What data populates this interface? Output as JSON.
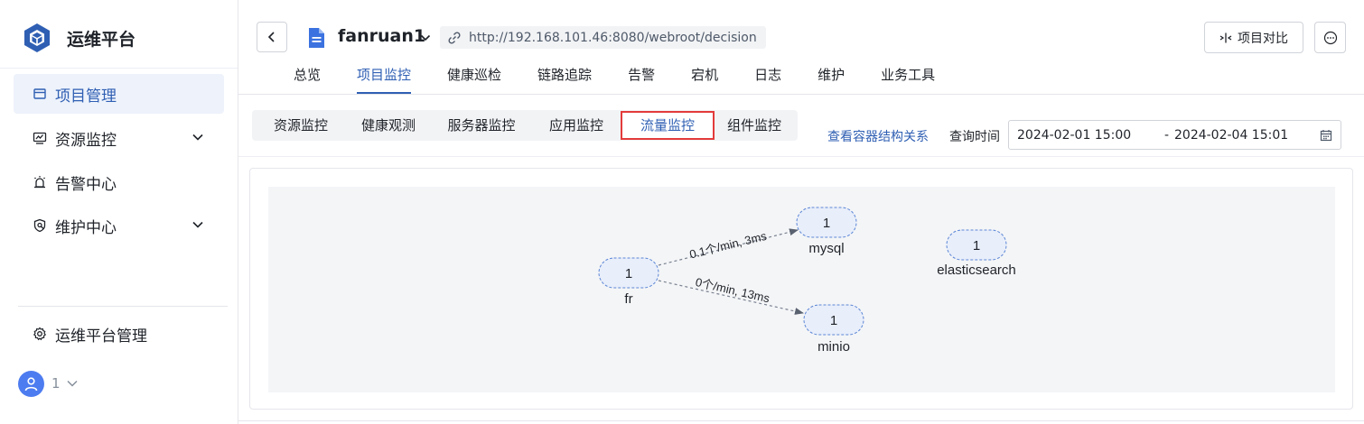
{
  "sidebar": {
    "brand": "运维平台",
    "menu": [
      {
        "label": "项目管理",
        "icon": "folder-icon",
        "active": true,
        "expandable": false
      },
      {
        "label": "资源监控",
        "icon": "monitor-chart-icon",
        "active": false,
        "expandable": true
      },
      {
        "label": "告警中心",
        "icon": "alarm-icon",
        "active": false,
        "expandable": false
      },
      {
        "label": "维护中心",
        "icon": "shield-wrench-icon",
        "active": false,
        "expandable": true
      }
    ],
    "admin": {
      "label": "运维平台管理",
      "icon": "gear-icon"
    },
    "user": {
      "name": "1",
      "icon": "user-icon"
    }
  },
  "header": {
    "project_name": "fanruan1",
    "url": "http://192.168.101.46:8080/webroot/decision",
    "compare_label": "项目对比"
  },
  "top_tabs": [
    "总览",
    "项目监控",
    "健康巡检",
    "链路追踪",
    "告警",
    "宕机",
    "日志",
    "维护",
    "业务工具"
  ],
  "top_tab_active": "项目监控",
  "sub_tabs": [
    "资源监控",
    "健康观测",
    "服务器监控",
    "应用监控",
    "流量监控",
    "组件监控"
  ],
  "sub_tab_active": "流量监控",
  "toolbar": {
    "view_link": "查看容器结构关系",
    "query_label": "查询时间",
    "date_start": "2024-02-01 15:00",
    "date_sep": "-",
    "date_end": "2024-02-04 15:01"
  },
  "graph": {
    "nodes": [
      {
        "id": "fr",
        "count": "1",
        "label": "fr"
      },
      {
        "id": "mysql",
        "count": "1",
        "label": "mysql"
      },
      {
        "id": "minio",
        "count": "1",
        "label": "minio"
      },
      {
        "id": "elasticsearch",
        "count": "1",
        "label": "elasticsearch"
      }
    ],
    "edges": [
      {
        "from": "fr",
        "to": "mysql",
        "label": "0.1个/min, 3ms"
      },
      {
        "from": "fr",
        "to": "minio",
        "label": "0个/min, 13ms"
      }
    ]
  },
  "colors": {
    "accent": "#2f5fb3",
    "highlight_border": "#e33b3b",
    "node_fill": "#e8eefa",
    "node_stroke": "#5b86d6"
  }
}
